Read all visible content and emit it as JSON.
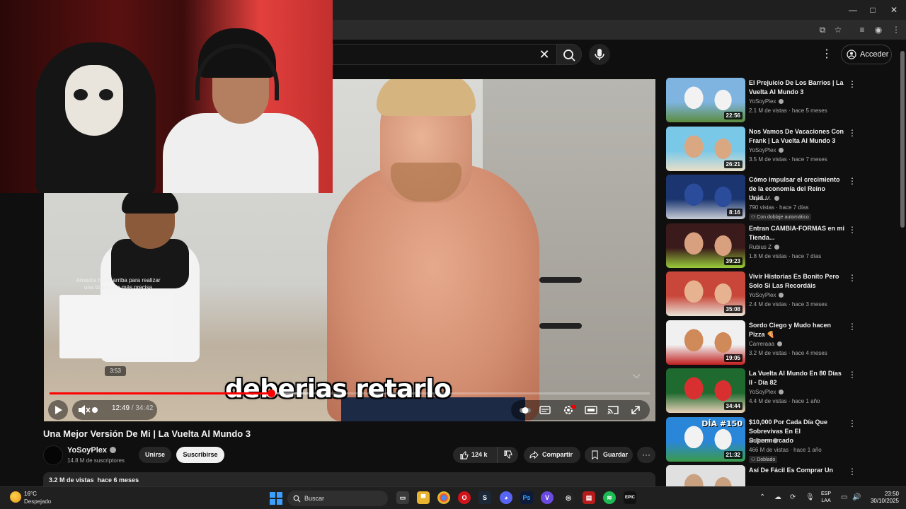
{
  "window": {
    "minimize": "—",
    "maximize": "□",
    "close": "✕"
  },
  "header": {
    "search_placeholder": "",
    "signin_label": "Acceder"
  },
  "player": {
    "caption": "deberias retarlo",
    "drag_hint": "Arrastra hacia arriba para realizar una búsqueda más precisa",
    "preview_time": "3:53",
    "current_time": "12:49",
    "duration": "34:42",
    "progress": 0.369,
    "buffered": 0.43
  },
  "video": {
    "title": "Una Mejor Versión De Mi | La Vuelta Al Mundo 3",
    "channel": "YoSoyPlex",
    "subscribers": "14.8 M de suscriptores",
    "join_label": "Unirse",
    "subscribe_label": "Suscribirse",
    "likes": "124 k",
    "share_label": "Compartir",
    "save_label": "Guardar",
    "description_meta": "3.2 M de vistas  hace 6 meses"
  },
  "recommendations": [
    {
      "title": "El Prejuicio De Los Barrios | La Vuelta Al Mundo 3",
      "channel": "YoSoyPlex",
      "verified": true,
      "meta": "2.1 M de vistas · hace 5 meses",
      "duration": "22:56",
      "colors": [
        "#7fb4e0",
        "#f2f2f2",
        "#5b8c3e"
      ]
    },
    {
      "title": "Nos Vamos De Vacaciones Con Frank | La Vuelta Al Mundo 3",
      "channel": "YoSoyPlex",
      "verified": true,
      "meta": "3.5 M de vistas · hace 7 meses",
      "duration": "26:21",
      "colors": [
        "#7ac8e8",
        "#d9a882",
        "#e9dfc8"
      ]
    },
    {
      "title": "Cómo impulsar el crecimiento de la economía del Reino Unid...",
      "channel": "City A.M.",
      "verified": true,
      "meta": "790 vistas · hace 7 días",
      "badge": "Con doblaje automático",
      "duration": "8:16",
      "colors": [
        "#1a3570",
        "#2b4c9a",
        "#c8ccd6"
      ]
    },
    {
      "title": "Entran CAMBIA-FORMAS en mi Tienda...",
      "channel": "Rubius Z",
      "verified": true,
      "meta": "1.8 M de vistas · hace 7 días",
      "duration": "39:23",
      "colors": [
        "#3a1a1a",
        "#d9a080",
        "#9acc3a"
      ]
    },
    {
      "title": "Vivir Historias Es Bonito Pero Solo Si Las Recordáis",
      "channel": "YoSoyPlex",
      "verified": true,
      "meta": "2.4 M de vistas · hace 3 meses",
      "duration": "35:08",
      "colors": [
        "#c8473a",
        "#e6b28f",
        "#e9e2d8"
      ]
    },
    {
      "title": "Sordo Ciego y Mudo hacen Pizza 🍕",
      "channel": "Carreraaa",
      "verified": true,
      "meta": "3.2 M de vistas · hace 4 meses",
      "duration": "19:05",
      "colors": [
        "#f0f0f0",
        "#d08a5a",
        "#c22020"
      ]
    },
    {
      "title": "La Vuelta Al Mundo En 80 Días II - Día 82",
      "channel": "YoSoyPlex",
      "verified": true,
      "meta": "4.4 M de vistas · hace 1 año",
      "duration": "34:44",
      "colors": [
        "#1f6a2e",
        "#d83030",
        "#e8d0b8"
      ]
    },
    {
      "title": "$10,000 Por Cada Día Que Sobrevivas En El Supermercado",
      "channel": "MrBeast",
      "verified": true,
      "meta": "466 M de vistas · hace 1 año",
      "badge": "Doblado",
      "duration": "21:32",
      "thumb_text": "DÍA #150",
      "colors": [
        "#2a86d8",
        "#f2f2f2",
        "#3c9b4a"
      ]
    },
    {
      "title": "Así De Fácil Es Comprar Un",
      "channel": "",
      "verified": false,
      "meta": "",
      "duration": "",
      "colors": [
        "#e0e0e0",
        "#c9a080",
        "#888"
      ]
    }
  ],
  "taskbar": {
    "temperature": "16°C",
    "condition": "Despejado",
    "search_label": "Buscar",
    "lang_line1": "ESP",
    "lang_line2": "LAA",
    "time": "23:50",
    "date": "30/10/2025"
  }
}
